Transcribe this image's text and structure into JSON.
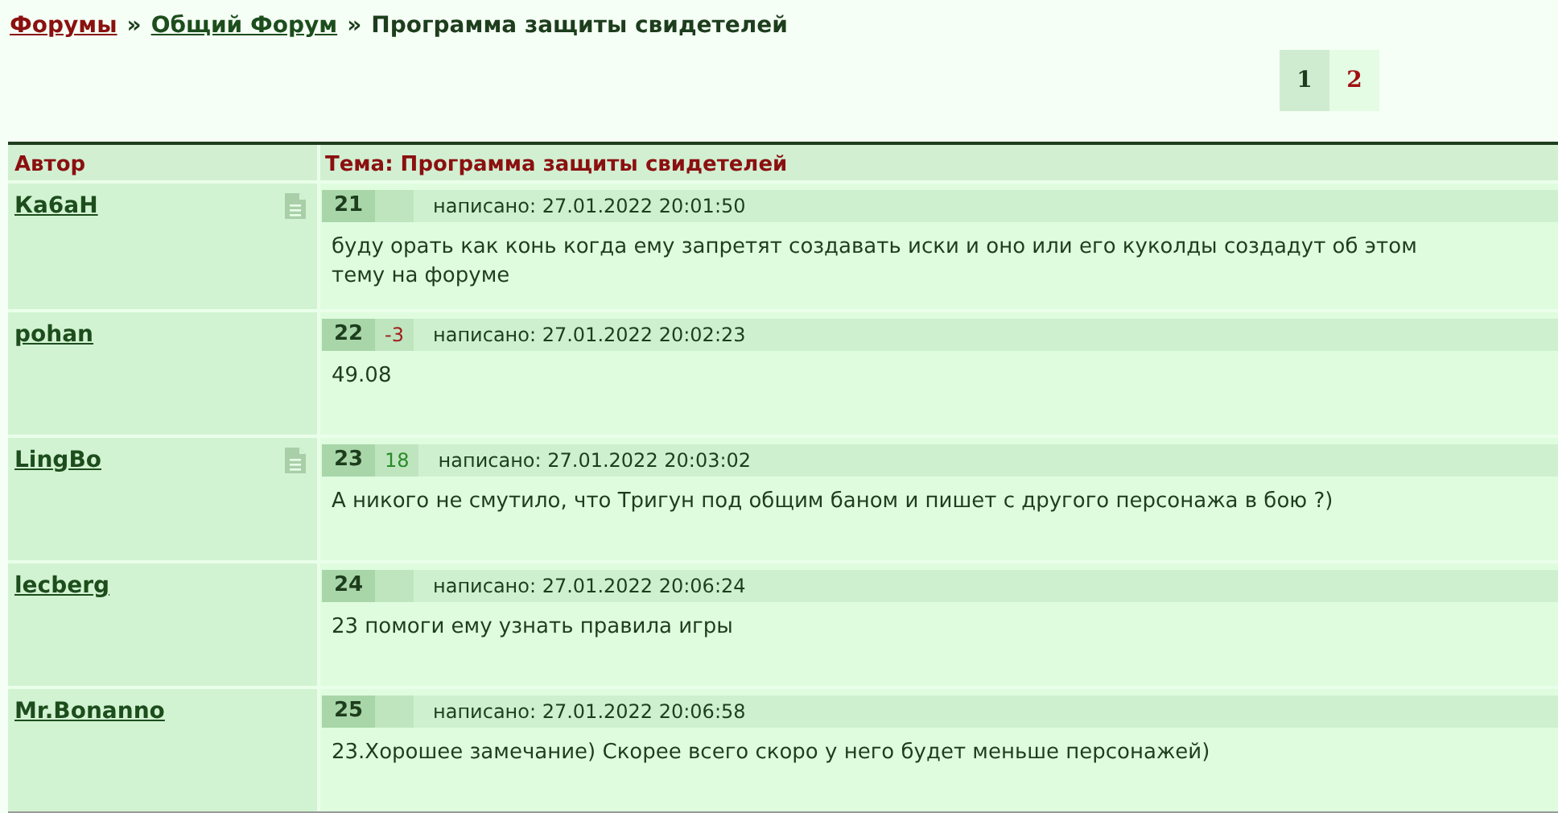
{
  "breadcrumb": [
    {
      "text": "Форумы",
      "kind": "link_root"
    },
    {
      "text": "»",
      "kind": "separator"
    },
    {
      "text": "Общий Форум",
      "kind": "link"
    },
    {
      "text": "»",
      "kind": "separator"
    },
    {
      "text": "Программа защиты свидетелей",
      "kind": "current"
    }
  ],
  "pagination": [
    {
      "label": "1",
      "selected": true
    },
    {
      "label": "2",
      "selected": false
    }
  ],
  "table": {
    "columns": [
      "Автор",
      "Тема: Программа защиты свидетелей"
    ],
    "posts": [
      {
        "author": "Ка6аН",
        "has_note": true,
        "number": "21",
        "date": "написано: 27.01.2022 20:01:50",
        "text": "буду орать как конь когда ему запретят создавать иски и оно или его куколды создадут об этом тему на форуме"
      },
      {
        "author": "pohan",
        "has_note": false,
        "number": "22",
        "rating": {
          "text": "-3",
          "kind": "negative"
        },
        "date": "написано: 27.01.2022 20:02:23",
        "text": "49.08"
      },
      {
        "author": "LingBo",
        "has_note": true,
        "number": "23",
        "rating": {
          "text": "18",
          "kind": "positive"
        },
        "date": "написано: 27.01.2022 20:03:02",
        "text": "А никого не смутило, что Тригун под общим баном и пишет с другого персонажа в бою ?)"
      },
      {
        "author": "lecberg",
        "has_note": false,
        "number": "24",
        "date": "написано: 27.01.2022 20:06:24",
        "text": "23 помоги ему узнать правила игры"
      },
      {
        "author": "Mr.Bonanno",
        "has_note": false,
        "number": "25",
        "date": "написано: 27.01.2022 20:06:58",
        "text": "23.Хорошее замечание) Скорее всего скоро у него будет меньше персонажей)"
      }
    ]
  }
}
